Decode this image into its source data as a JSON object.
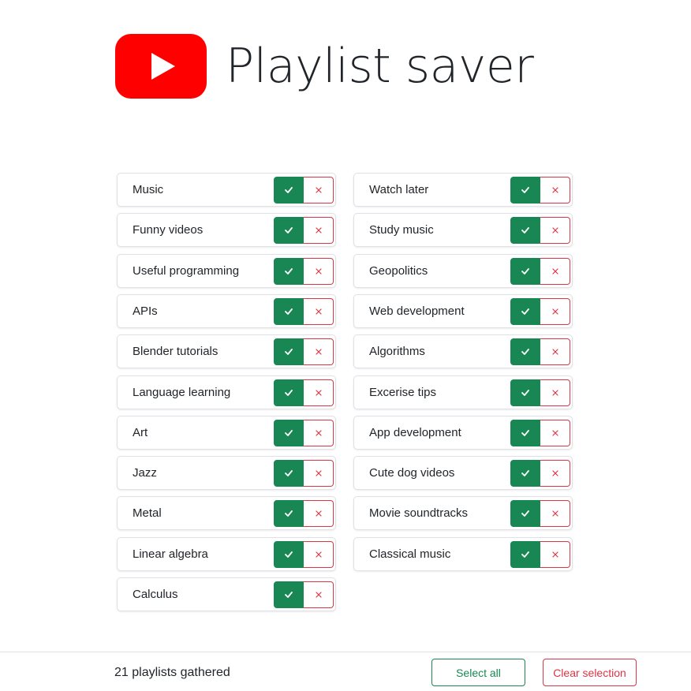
{
  "app": {
    "title": "Playlist saver"
  },
  "colors": {
    "brand_red": "#ff0000",
    "success": "#198754",
    "danger": "#dc3545"
  },
  "icons": {
    "logo": "youtube-logo-icon",
    "select": "check-icon",
    "deselect": "x-icon"
  },
  "playlists": {
    "left": [
      "Music",
      "Funny videos",
      "Useful programming",
      "APIs",
      "Blender tutorials",
      "Language learning",
      "Art",
      "Jazz",
      "Metal",
      "Linear algebra",
      "Calculus"
    ],
    "right": [
      "Watch later",
      "Study music",
      "Geopolitics",
      "Web development",
      "Algorithms",
      "Excerise tips",
      "App development",
      "Cute dog videos",
      "Movie soundtracks",
      "Classical music"
    ]
  },
  "footer": {
    "count_text": "21 playlists gathered",
    "select_all_label": "Select all",
    "clear_selection_label": "Clear selection"
  }
}
